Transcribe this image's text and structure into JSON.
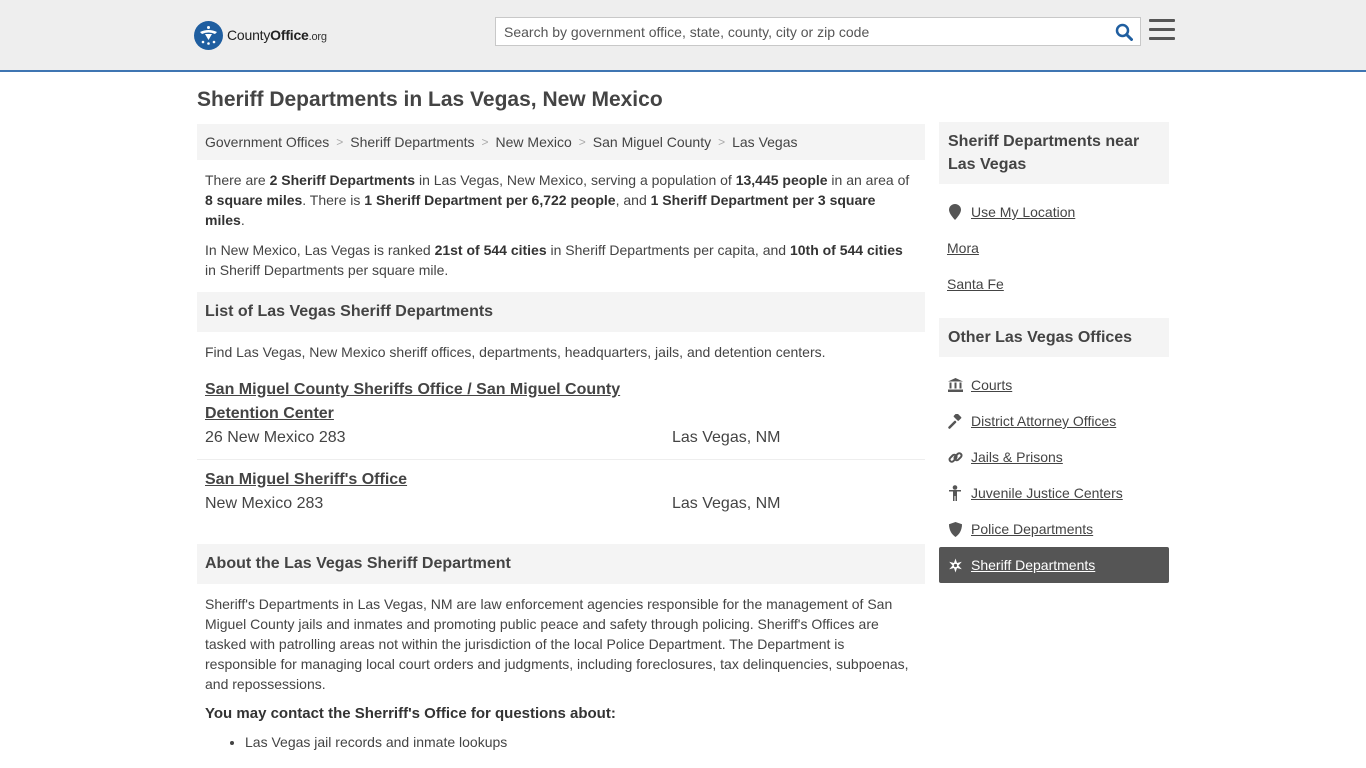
{
  "header": {
    "logo_text_main": "County",
    "logo_text_bold": "Office",
    "logo_text_tld": ".org",
    "search_placeholder": "Search by government office, state, county, city or zip code"
  },
  "page_title": "Sheriff Departments in Las Vegas, New Mexico",
  "breadcrumb": [
    "Government Offices",
    "Sheriff Departments",
    "New Mexico",
    "San Miguel County",
    "Las Vegas"
  ],
  "intro": {
    "p1_a": "There are ",
    "p1_b": "2 Sheriff Departments",
    "p1_c": " in Las Vegas, New Mexico, serving a population of ",
    "p1_d": "13,445 people",
    "p1_e": " in an area of ",
    "p1_f": "8 square miles",
    "p1_g": ". There is ",
    "p1_h": "1 Sheriff Department per 6,722 people",
    "p1_i": ", and ",
    "p1_j": "1 Sheriff Department per 3 square miles",
    "p1_k": ".",
    "p2_a": "In New Mexico, Las Vegas is ranked ",
    "p2_b": "21st of 544 cities",
    "p2_c": " in Sheriff Departments per capita, and ",
    "p2_d": "10th of 544 cities",
    "p2_e": " in Sheriff Departments per square mile."
  },
  "list_section": {
    "title": "List of Las Vegas Sheriff Departments",
    "description": "Find Las Vegas, New Mexico sheriff offices, departments, headquarters, jails, and detention centers.",
    "listings": [
      {
        "name": "San Miguel County Sheriffs Office / San Miguel County Detention Center",
        "address": "26 New Mexico 283",
        "city": "Las Vegas, NM"
      },
      {
        "name": "San Miguel Sheriff's Office",
        "address": "New Mexico 283",
        "city": "Las Vegas, NM"
      }
    ]
  },
  "about": {
    "title": "About the Las Vegas Sheriff Department",
    "paragraph": "Sheriff's Departments in Las Vegas, NM are law enforcement agencies responsible for the management of San Miguel County jails and inmates and promoting public peace and safety through policing. Sheriff's Offices are tasked with patrolling areas not within the jurisdiction of the local Police Department. The Department is responsible for managing local court orders and judgments, including foreclosures, tax delinquencies, subpoenas, and repossessions.",
    "contact_title": "You may contact the Sherriff's Office for questions about:",
    "contact_items": [
      "Las Vegas jail records and inmate lookups"
    ]
  },
  "sidebar": {
    "near_title": "Sheriff Departments near Las Vegas",
    "near_items": [
      "Use My Location",
      "Mora",
      "Santa Fe"
    ],
    "other_title": "Other Las Vegas Offices",
    "other_items": [
      {
        "label": "Courts",
        "icon": "courthouse-icon"
      },
      {
        "label": "District Attorney Offices",
        "icon": "gavel-icon"
      },
      {
        "label": "Jails & Prisons",
        "icon": "chain-link-icon"
      },
      {
        "label": "Juvenile Justice Centers",
        "icon": "child-icon"
      },
      {
        "label": "Police Departments",
        "icon": "shield-icon"
      },
      {
        "label": "Sheriff Departments",
        "icon": "sheriff-star-icon"
      }
    ]
  },
  "colors": {
    "accent": "#3f75b2",
    "header_bg": "#eeeeee",
    "active_bg": "#555555"
  }
}
